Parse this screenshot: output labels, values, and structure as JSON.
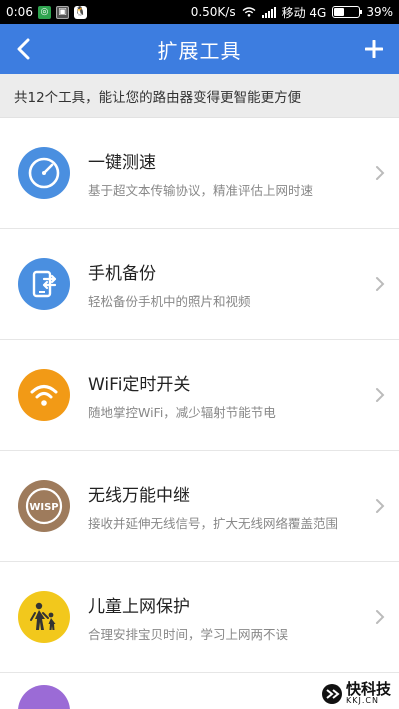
{
  "status_bar": {
    "time": "0:06",
    "speed": "0.50K/s",
    "carrier": "移动 4G",
    "battery": "39%",
    "battery_level": 0.39
  },
  "nav": {
    "title": "扩展工具",
    "add_label": "+"
  },
  "subtitle": "共12个工具，能让您的路由器变得更智能更方便",
  "tools": [
    {
      "name": "一键测速",
      "desc": "基于超文本传输协议，精准评估上网时速",
      "icon": "speedometer-icon",
      "color": "#4a8fe0"
    },
    {
      "name": "手机备份",
      "desc": "轻松备份手机中的照片和视频",
      "icon": "phone-backup-icon",
      "color": "#4a8fe0"
    },
    {
      "name": "WiFi定时开关",
      "desc": "随地掌控WiFi，减少辐射节能节电",
      "icon": "wifi-icon",
      "color": "#f29a16"
    },
    {
      "name": "无线万能中继",
      "desc": "接收并延伸无线信号，扩大无线网络覆盖范围",
      "icon": "wisp-icon",
      "icon_text": "WISP",
      "color": "#9e7b5c"
    },
    {
      "name": "儿童上网保护",
      "desc": "合理安排宝贝时间，学习上网两不误",
      "icon": "child-protection-icon",
      "color": "#f2c81c"
    }
  ],
  "watermark": {
    "cn": "快科技",
    "en": "KKJ.CN"
  }
}
